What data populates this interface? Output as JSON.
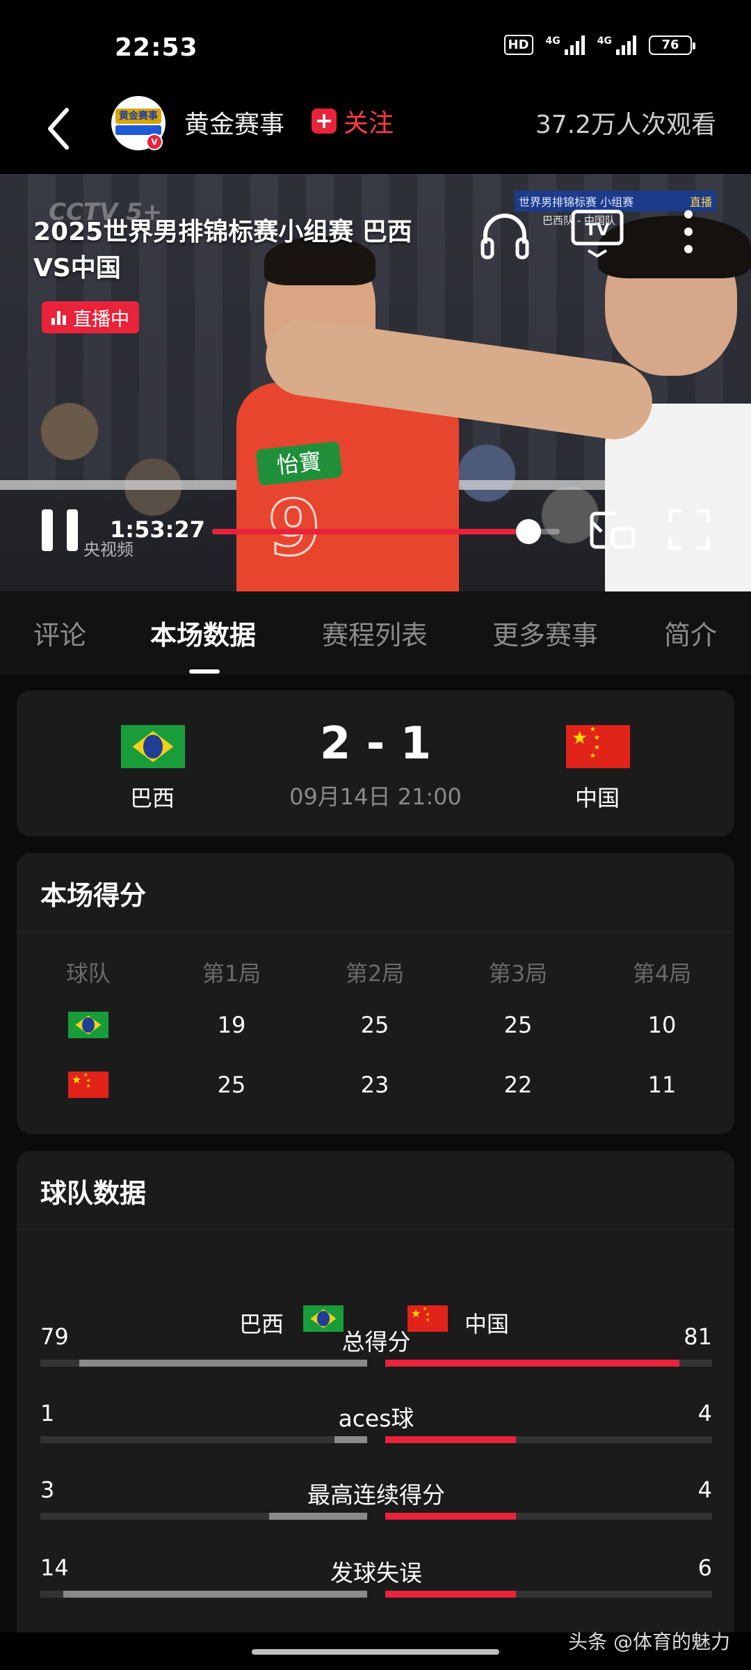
{
  "status_bar": {
    "time": "22:53",
    "hd": "HD",
    "net1": "4G",
    "net2": "4G",
    "battery": "76"
  },
  "header": {
    "channel_name": "黄金赛事",
    "follow_label": "关注",
    "viewers": "37.2万人次观看"
  },
  "video": {
    "title": "2025世界男排锦标赛小组赛 巴西 VS中国",
    "live_label": "直播中",
    "watermark_cctv": "CCTV 5+",
    "watermark_app": "央视频",
    "score_bug_title": "世界男排锦标赛 小组赛",
    "score_bug_live": "直播",
    "score_bug_sub": "巴西队 - 中国队",
    "current_time": "1:53:27",
    "progress": 0.91
  },
  "tabs": [
    {
      "label": "评论",
      "active": false
    },
    {
      "label": "本场数据",
      "active": true
    },
    {
      "label": "赛程列表",
      "active": false
    },
    {
      "label": "更多赛事",
      "active": false
    },
    {
      "label": "简介",
      "active": false
    }
  ],
  "match": {
    "home_team": "巴西",
    "away_team": "中国",
    "score": "2 - 1",
    "datetime": "09月14日 21:00"
  },
  "set_scores": {
    "title": "本场得分",
    "headers": [
      "球队",
      "第1局",
      "第2局",
      "第3局",
      "第4局"
    ],
    "rows": [
      {
        "team": "巴西",
        "flag": "brazil-flag",
        "sets": [
          "19",
          "25",
          "25",
          "10"
        ]
      },
      {
        "team": "中国",
        "flag": "china-flag",
        "sets": [
          "25",
          "23",
          "22",
          "11"
        ]
      }
    ]
  },
  "team_stats": {
    "title": "球队数据",
    "home_label": "巴西",
    "away_label": "中国",
    "stats": [
      {
        "label": "总得分",
        "home": "79",
        "away": "81",
        "home_frac": 0.88,
        "away_frac": 0.9
      },
      {
        "label": "aces球",
        "home": "1",
        "away": "4",
        "home_frac": 0.1,
        "away_frac": 0.4
      },
      {
        "label": "最高连续得分",
        "home": "3",
        "away": "4",
        "home_frac": 0.3,
        "away_frac": 0.4
      },
      {
        "label": "发球失误",
        "home": "14",
        "away": "6",
        "home_frac": 0.93,
        "away_frac": 0.4
      }
    ]
  },
  "footer": {
    "watermark": "头条 @体育的魅力"
  },
  "colors": {
    "accent": "#e8233a",
    "card_bg": "#1b1b1b",
    "page_bg": "#0b0b0b"
  }
}
